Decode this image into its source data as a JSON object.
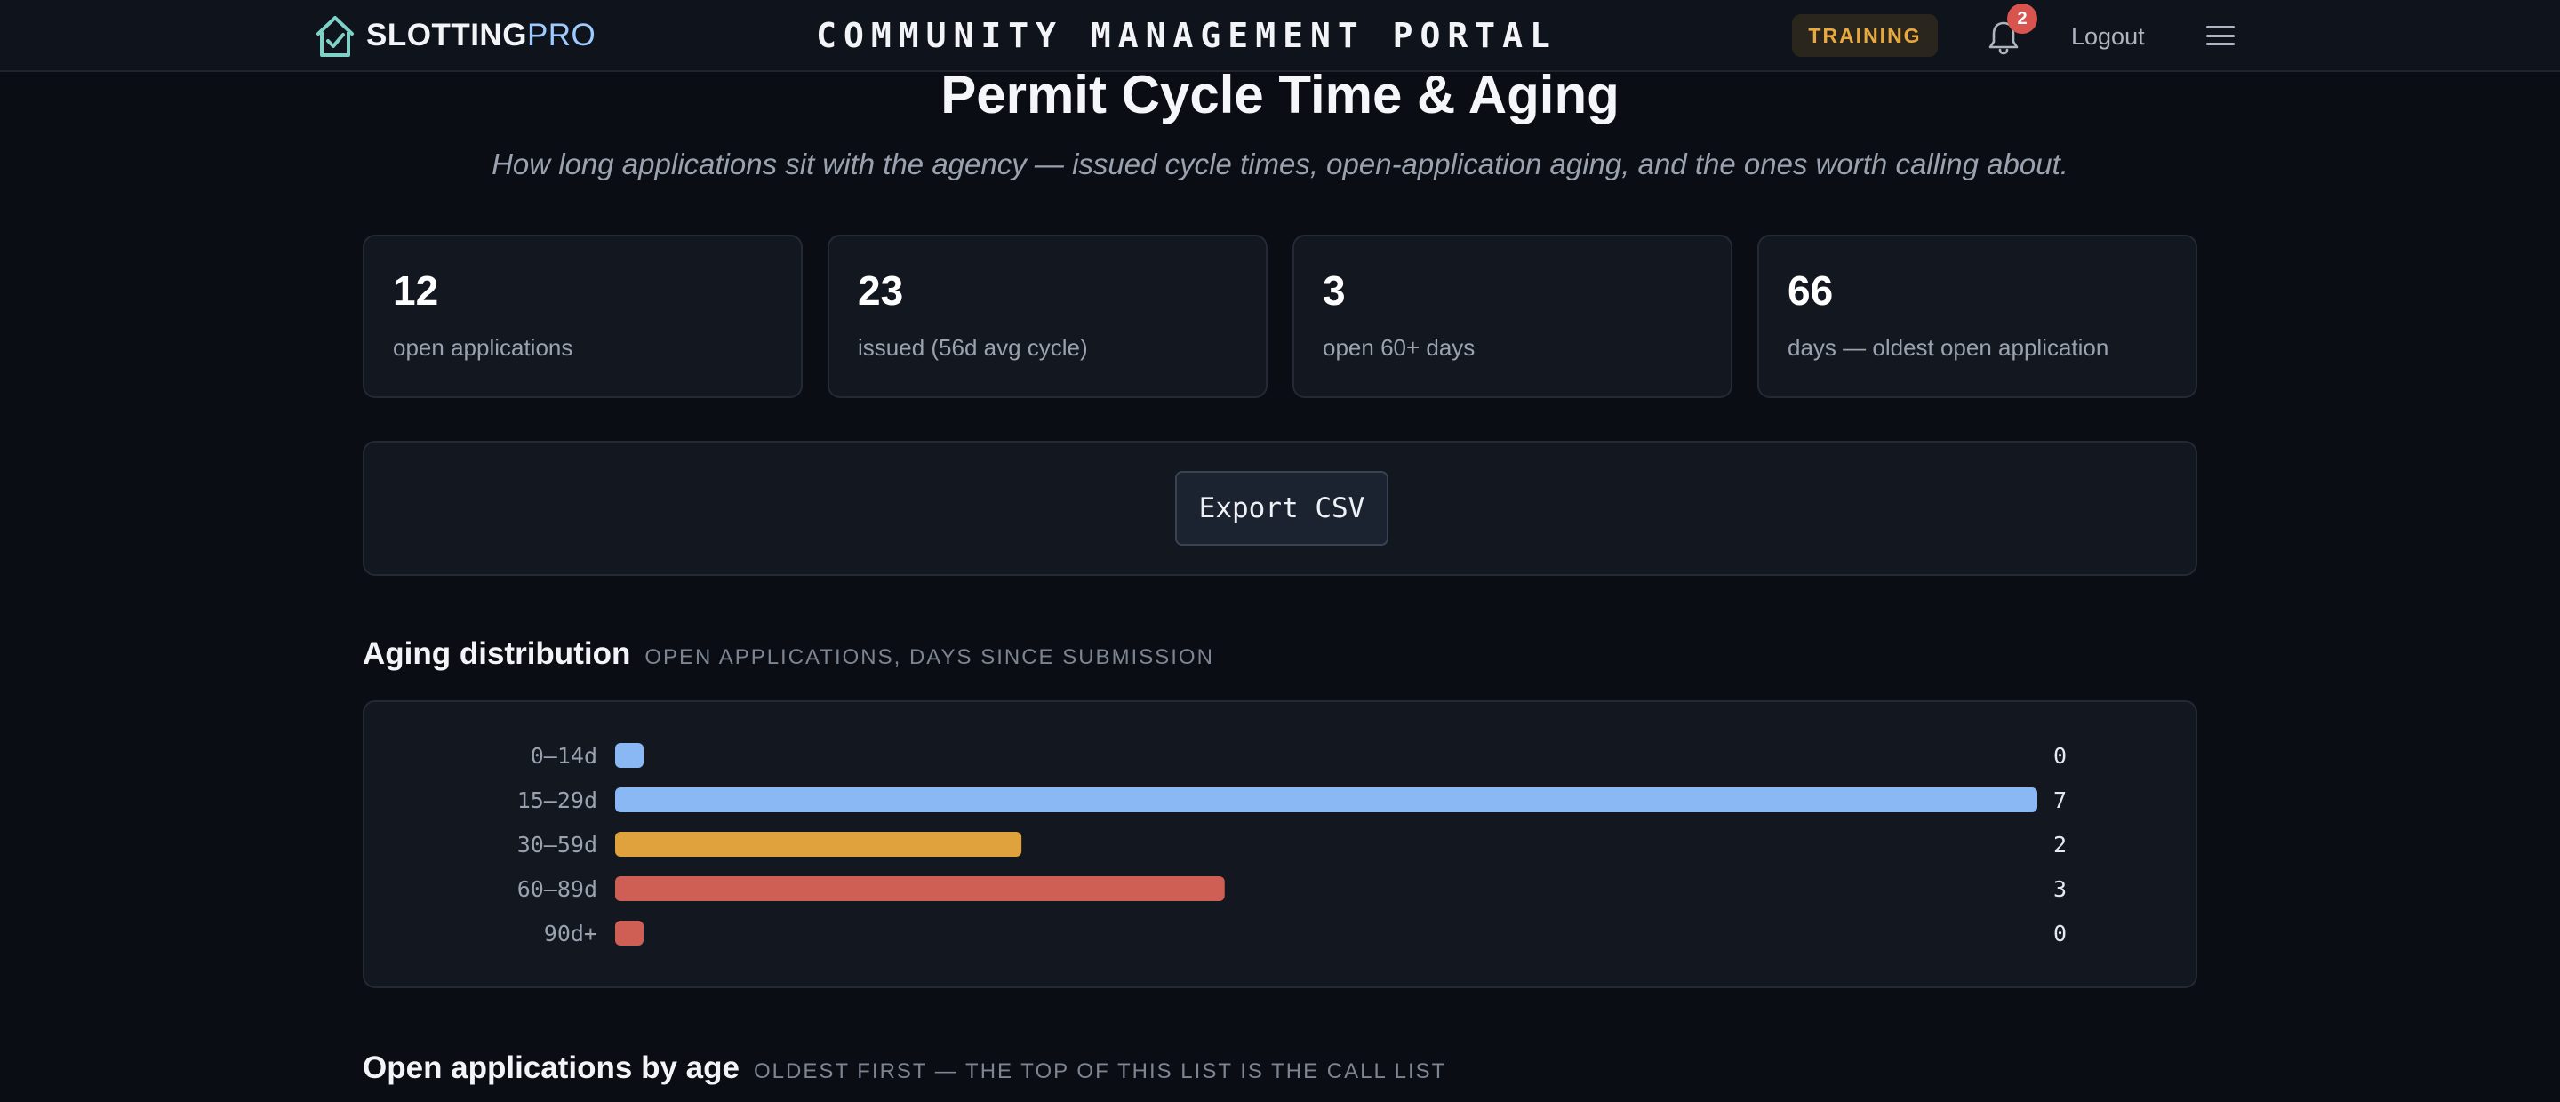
{
  "header": {
    "brand_primary": "SLOTTING",
    "brand_secondary": "PRO",
    "portal_title": "COMMUNITY MANAGEMENT PORTAL",
    "mode_badge": "TRAINING",
    "notification_count": "2",
    "logout_label": "Logout",
    "icons": [
      "house-check-logo",
      "bell-icon",
      "menu-icon"
    ]
  },
  "page": {
    "title": "Permit Cycle Time & Aging",
    "subtitle": "How long applications sit with the agency — issued cycle times, open-application aging, and the ones worth calling about."
  },
  "stats": [
    {
      "value": "12",
      "label": "open applications"
    },
    {
      "value": "23",
      "label": "issued (56d avg cycle)"
    },
    {
      "value": "3",
      "label": "open 60+ days"
    },
    {
      "value": "66",
      "label": "days — oldest open application"
    }
  ],
  "export": {
    "label": "Export CSV"
  },
  "aging": {
    "title": "Aging distribution",
    "subtitle": "OPEN APPLICATIONS, DAYS SINCE SUBMISSION"
  },
  "chart_data": {
    "type": "bar",
    "orientation": "horizontal",
    "categories": [
      "0–14d",
      "15–29d",
      "30–59d",
      "60–89d",
      "90d+"
    ],
    "values": [
      0,
      7,
      2,
      3,
      0
    ],
    "colors": [
      "#8ab8f5",
      "#8ab8f5",
      "#dfa23d",
      "#cf5f55",
      "#cf5f55"
    ],
    "xlim": [
      0,
      7
    ],
    "grid": false,
    "legend": "none"
  },
  "open_list": {
    "title": "Open applications by age",
    "subtitle": "OLDEST FIRST — THE TOP OF THIS LIST IS THE CALL LIST"
  }
}
